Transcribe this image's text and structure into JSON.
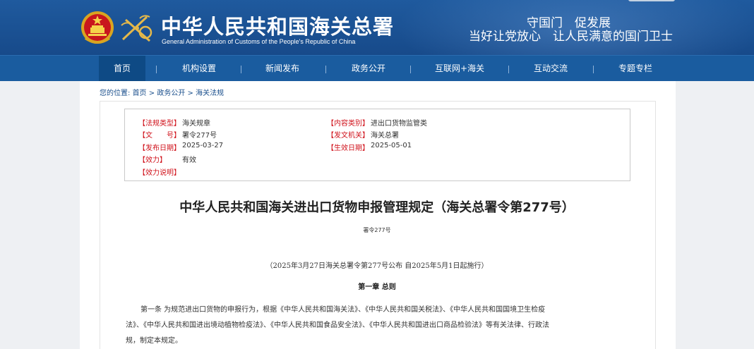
{
  "header": {
    "title": "中华人民共和国海关总署",
    "subtitle": "General Administration of Customs of the People's Republic of China",
    "slogan_line1": "守国门　促发展",
    "slogan_line2": "当好让党放心　让人民满意的国门卫士",
    "emblem_icon": "national-emblem-icon",
    "logo_icon": "customs-emblem-icon"
  },
  "nav": {
    "items": [
      "首页",
      "机构设置",
      "新闻发布",
      "政务公开",
      "互联网+海关",
      "互动交流",
      "专题专栏"
    ],
    "active": "首页"
  },
  "breadcrumb": {
    "prefix": "您的位置:",
    "path": [
      "首页",
      "政务公开",
      "海关法规"
    ],
    "separator": ">"
  },
  "meta": {
    "law_type_label": "【法规类型】",
    "law_type": "海关规章",
    "content_category_label": "【内容类别】",
    "content_category": "进出口货物监管类",
    "doc_no_label": "【文　　号】",
    "doc_no": "署令277号",
    "issuer_label": "【发文机关】",
    "issuer": "海关总署",
    "publish_date_label": "【发布日期】",
    "publish_date": "2025-03-27",
    "effective_date_label": "【生效日期】",
    "effective_date": "2025-05-01",
    "validity_label": "【效力】",
    "validity": "有效",
    "validity_note_label": "【效力说明】",
    "validity_note": ""
  },
  "document": {
    "title": "中华人民共和国海关进出口货物申报管理规定（海关总署令第277号）",
    "number": "署令277号",
    "promulgation": "（2025年3月27日海关总署令第277号公布 自2025年5月1日起施行）",
    "chapter": "第一章 总则",
    "article1_line1": "第一条 为规范进出口货物的申报行为，根据《中华人民共和国海关法》、《中华人民共和国关税法》、《中华人民共和国国境卫生检疫",
    "article1_line2": "法》、《中华人民共和国进出境动植物检疫法》、《中华人民共和国食品安全法》、《中华人民共和国进出口商品检验法》等有关法律、行政法",
    "article1_line3": "规，制定本规定。"
  },
  "colors": {
    "header_bg": "#1f5a9e",
    "nav_bg": "#1a5c9f",
    "nav_active": "#0e4a85",
    "label_red": "#d0121b",
    "link_blue": "#1a4f8c"
  }
}
